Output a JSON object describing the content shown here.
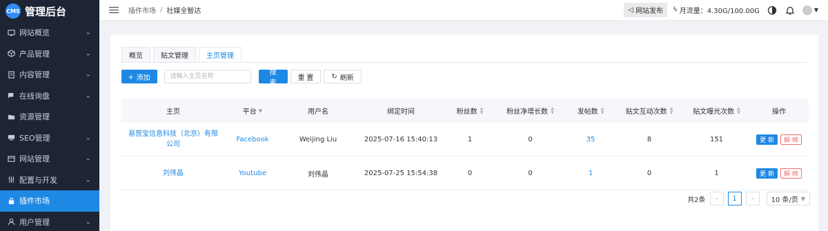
{
  "app": {
    "logo": "CMS",
    "title": "管理后台"
  },
  "sidebar": {
    "items": [
      {
        "label": "网站概览",
        "icon": "dashboard-icon"
      },
      {
        "label": "产品管理",
        "icon": "box-icon"
      },
      {
        "label": "内容管理",
        "icon": "document-icon"
      },
      {
        "label": "在线询盘",
        "icon": "chat-icon"
      },
      {
        "label": "资源管理",
        "icon": "folder-icon"
      },
      {
        "label": "SEO管理",
        "icon": "monitor-icon"
      },
      {
        "label": "网站管理",
        "icon": "browser-icon"
      },
      {
        "label": "配置与开发",
        "icon": "sliders-icon"
      },
      {
        "label": "插件市场",
        "icon": "lock-icon"
      },
      {
        "label": "用户管理",
        "icon": "user-icon"
      }
    ],
    "active_index": 8,
    "accent": "#1e88e5",
    "bg": "#1d2433"
  },
  "header": {
    "breadcrumb": [
      "插件市场",
      "社媒全智达"
    ],
    "publish_label": "网站发布",
    "traffic_label": "月流量：4.30G/100.00G"
  },
  "tabs": [
    "概览",
    "贴文管理",
    "主页管理"
  ],
  "active_tab": 2,
  "toolbar": {
    "add_label": "添加",
    "search_placeholder": "请输入主页名称",
    "search_label": "搜 索",
    "reset_label": "重 置",
    "refresh_label": "刷新"
  },
  "table": {
    "headers": [
      "主页",
      "平台",
      "用户名",
      "绑定时间",
      "粉丝数",
      "粉丝净增长数",
      "发帖数",
      "贴文互动次数",
      "贴文曝光次数",
      "操作"
    ],
    "rows": [
      {
        "page": "易营宝信息科技（北京）有限公司",
        "platform": "Facebook",
        "username": "Weijing Liu",
        "bind_time": "2025-07-16 15:40:13",
        "fans": "1",
        "fans_growth": "0",
        "posts": "35",
        "interactions": "8",
        "impressions": "151",
        "update_label": "更 新",
        "unbind_label": "解 绑"
      },
      {
        "page": "刘伟晶",
        "platform": "Youtube",
        "username": "刘伟晶",
        "bind_time": "2025-07-25 15:54:38",
        "fans": "0",
        "fans_growth": "0",
        "posts": "1",
        "interactions": "0",
        "impressions": "1",
        "update_label": "更 新",
        "unbind_label": "解 绑"
      }
    ]
  },
  "pagination": {
    "total_label": "共2条",
    "current_page": "1",
    "page_size_label": "10 条/页"
  }
}
